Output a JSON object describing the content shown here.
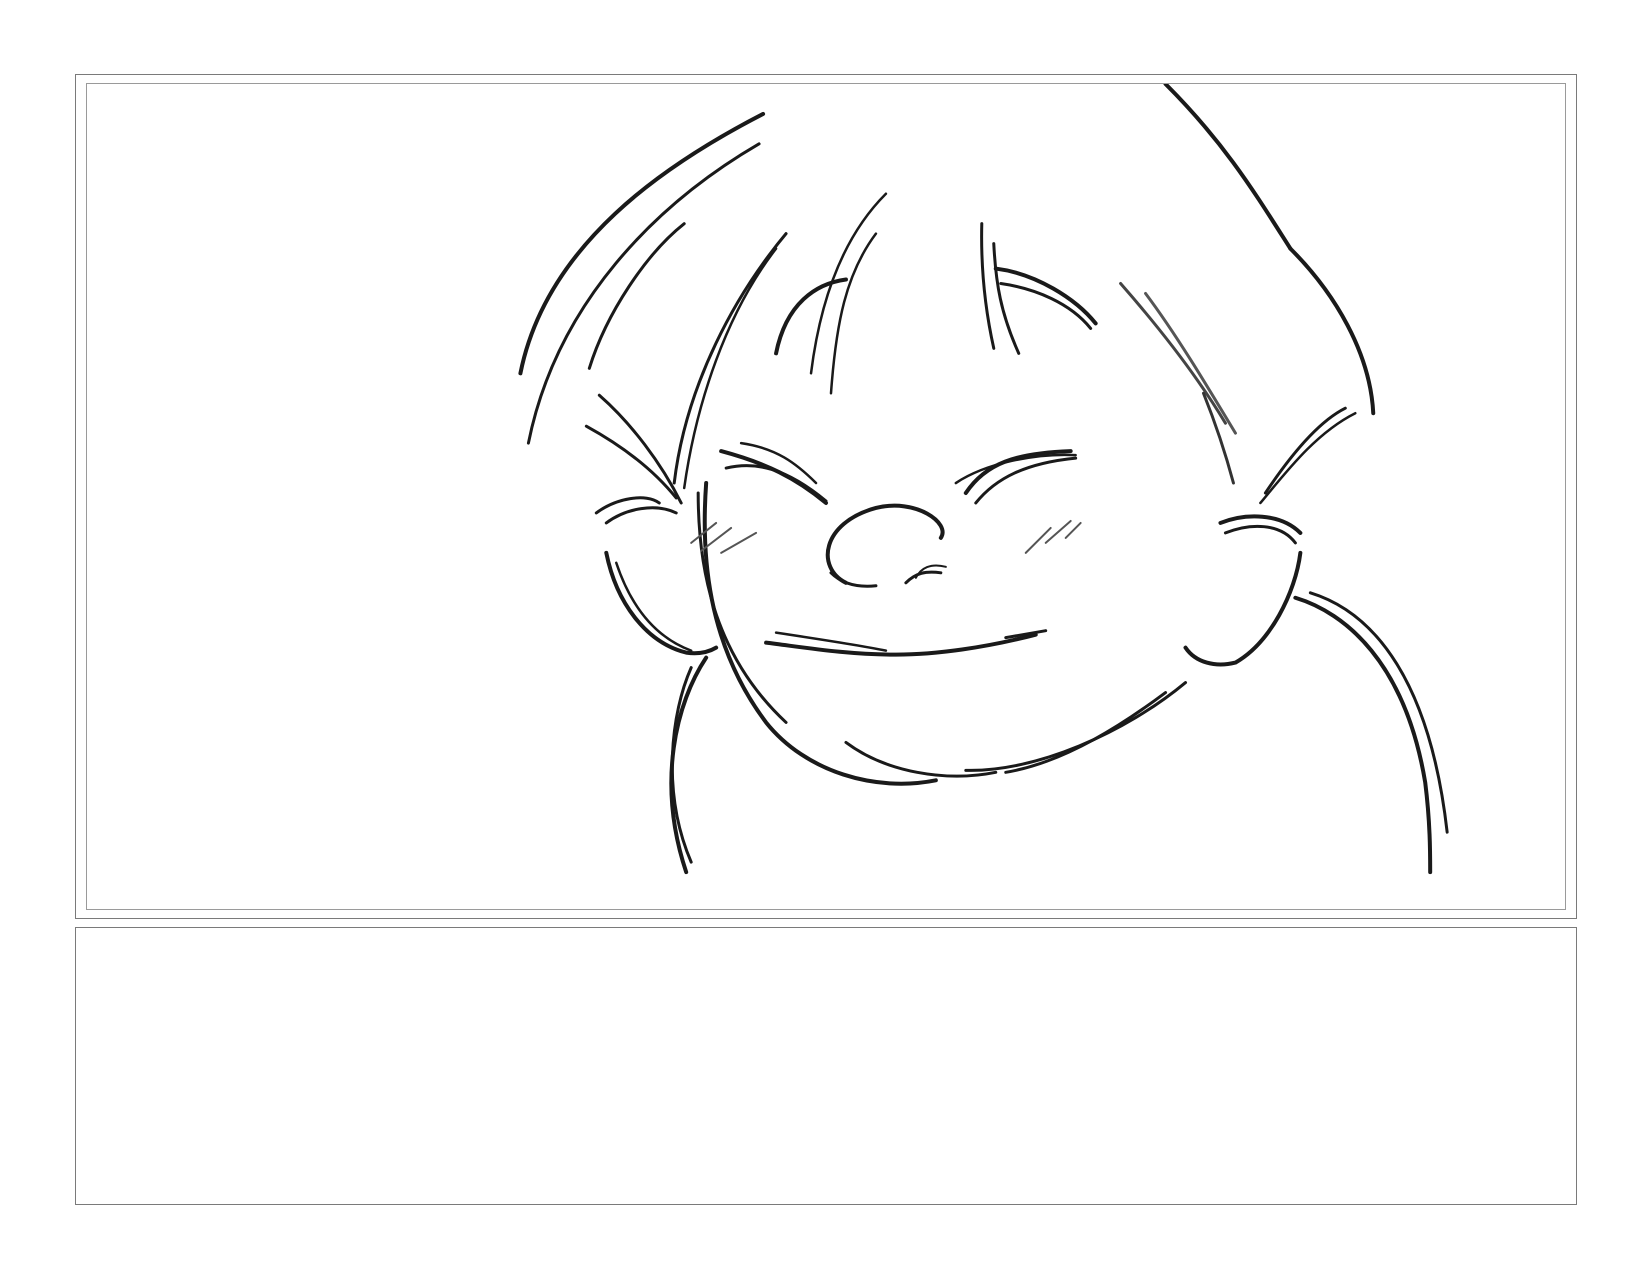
{
  "storyboard": {
    "panel": {
      "subject": "child-face-sketch",
      "expression": "eyes-squeezed-smile",
      "line_color": "#1a1a1a"
    },
    "notes": {
      "text": ""
    }
  }
}
